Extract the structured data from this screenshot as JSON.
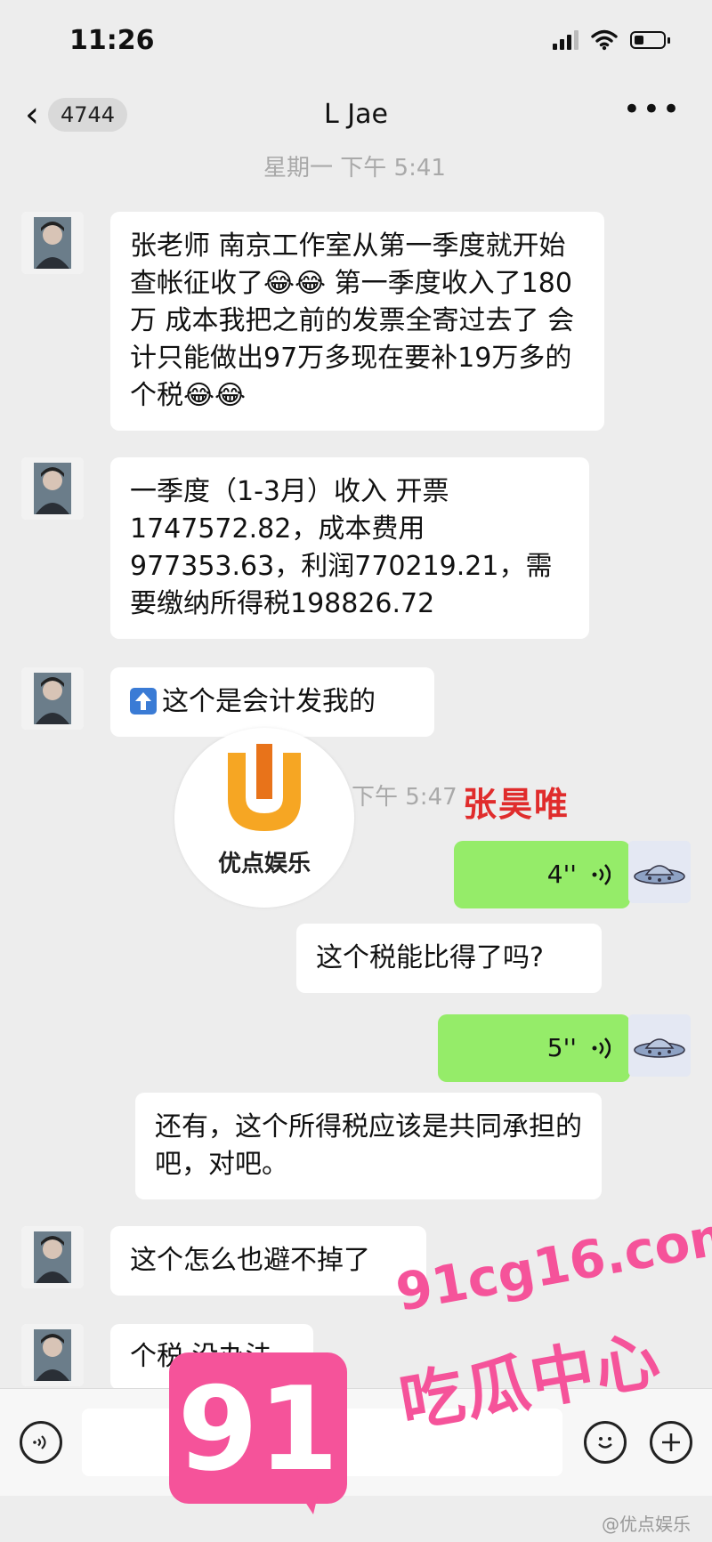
{
  "status_bar": {
    "time": "11:26",
    "battery_level": 0.35
  },
  "nav": {
    "unread_count": "4744",
    "title": "L Jae"
  },
  "timestamps": {
    "first": "星期一 下午 5:41",
    "second": "下午 5:47"
  },
  "messages": [
    {
      "from": "them",
      "text": "张老师 南京工作室从第一季度就开始查帐征收了😂😂 第一季度收入了180万 成本我把之前的发票全寄过去了 会计只能做出97万多现在要补19万多的个税😂😂"
    },
    {
      "from": "them",
      "text": "一季度（1-3月）收入 开票1747572.82，成本费用977353.63，利润770219.21，需要缴纳所得税198826.72"
    },
    {
      "from": "them",
      "text": "这个是会计发我的"
    },
    {
      "from": "me",
      "type": "voice",
      "duration": "4''"
    },
    {
      "from": "me",
      "text": "这个税能比得了吗?"
    },
    {
      "from": "me",
      "type": "voice",
      "duration": "5''"
    },
    {
      "from": "me",
      "text": "还有，这个所得税应该是共同承担的吧，对吧。"
    },
    {
      "from": "them",
      "text": "这个怎么也避不掉了"
    },
    {
      "from": "them",
      "text": "个税 没办法"
    }
  ],
  "overlays": {
    "logo_text": "优点娱乐",
    "red_name": "张昊唯",
    "wm_number": "91",
    "wm_url": "91cg16.com",
    "wm_cn": "吃瓜中心",
    "weibo_mark": "@优点娱乐"
  },
  "colors": {
    "voice_bubble": "#95ec69",
    "background": "#ededed",
    "watermark": "#f5539a"
  }
}
